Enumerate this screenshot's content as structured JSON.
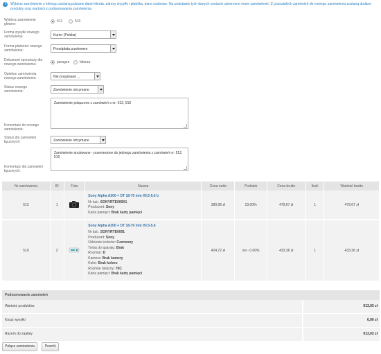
{
  "info": {
    "text": "Wybierz zamówienie z którego zostaną pobrane dane klienta, adresy wysyłki i płatnika, dane osobowe. Na podstawie tych danych zostanie utworzone nowe zamówienie. Z pozostałych zamówień do nowego zamówienia zostaną dodane produkty oraz wartości z podsumowania zamówienia."
  },
  "form": {
    "main_order": {
      "label": "Wybierz zamówienie główne:",
      "options": [
        "512",
        "510"
      ],
      "selected": "512"
    },
    "shipping": {
      "label": "Forma wysyłki nowego zamówienia:",
      "value": "Kurier (Polska)"
    },
    "payment": {
      "label": "Forma płatności nowego zamówienia:",
      "value": "Przedpłata przelewem"
    },
    "sales_doc": {
      "label": "Dokument sprzedaży dla nowego zamówienia:",
      "options": [
        "paragon",
        "faktura"
      ],
      "selected": "paragon"
    },
    "caretaker": {
      "label": "Opiekun zamówienia nowego zamówienia:",
      "value": "Nie przypisane ..."
    },
    "status_new": {
      "label": "Status nowego zamówienia:",
      "value": "Zamówienie otrzymane"
    },
    "comment_new": {
      "label": "Komentarz do nowego zamówienia:",
      "value": "Zamówienie połączone z zamówień o nr: 512, 510"
    },
    "status_merged": {
      "label": "Status dla zamówień łączonych:",
      "value": "Zamówienie otrzymane"
    },
    "comment_merged": {
      "label": "Komentarz dla zamówień łączonych:",
      "value": "Zamówienie anulowane - przeniesione do jednego zamówienia z zamówień nr: 512, 510"
    }
  },
  "table": {
    "headers": [
      "Nr zamówienia",
      "ID",
      "Foto",
      "Nazwa",
      "Cena netto",
      "Podatek",
      "Cena brutto",
      "Ilość",
      "Wartość brutto"
    ],
    "rows": [
      {
        "order_no": "512",
        "id": "1",
        "name": "Sony Alpha A200 + DT 18-70 mm f/3.5-5.6 b",
        "attrs": [
          {
            "k": "Nr kat.: ",
            "v": "SONYRTE009X1"
          },
          {
            "k": "Producent: ",
            "v": "Sony"
          },
          {
            "k": "Karta pamięci: ",
            "v": "Brak karty pamięci"
          }
        ],
        "net": "389,98 zł",
        "tax": "23.00%",
        "gross": "479,67 zł",
        "qty": "1",
        "total": "479,67 zł"
      },
      {
        "order_no": "510",
        "id": "2",
        "name": "Sony Alpha A200 + DT 18-70 mm f/3.5-5.6",
        "attrs": [
          {
            "k": "Nr kat.: ",
            "v": "SONYRTE0091"
          },
          {
            "k": "Producent: ",
            "v": "Sony"
          },
          {
            "k": "Odcienie kolorów: ",
            "v": "Czerwony"
          },
          {
            "k": "Torba do aparatu: ",
            "v": "Brak"
          },
          {
            "k": "Rozmiar: ",
            "v": "D"
          },
          {
            "k": "Kamera: ",
            "v": "Brak kamery"
          },
          {
            "k": "Kolor: ",
            "v": "Brak koloru"
          },
          {
            "k": "Rozmiar bielizny: ",
            "v": "70C"
          },
          {
            "k": "Karta pamięci: ",
            "v": "Brak karty pamięci"
          }
        ],
        "net": "424,72 zł",
        "tax": "zw - 0.00%",
        "gross": "433,36 zł",
        "qty": "1",
        "total": "433,36 zł"
      }
    ]
  },
  "summary": {
    "title": "Podsumowanie zamówień",
    "rows": [
      {
        "label": "Wartość produktów",
        "value": "913,03 zł"
      },
      {
        "label": "Koszt wysyłki",
        "value": "0,00 zł"
      },
      {
        "label": "Razem do zapłaty",
        "value": "913,03 zł"
      }
    ]
  },
  "buttons": {
    "merge": "Połącz zamówienia",
    "back": "Powrót"
  }
}
